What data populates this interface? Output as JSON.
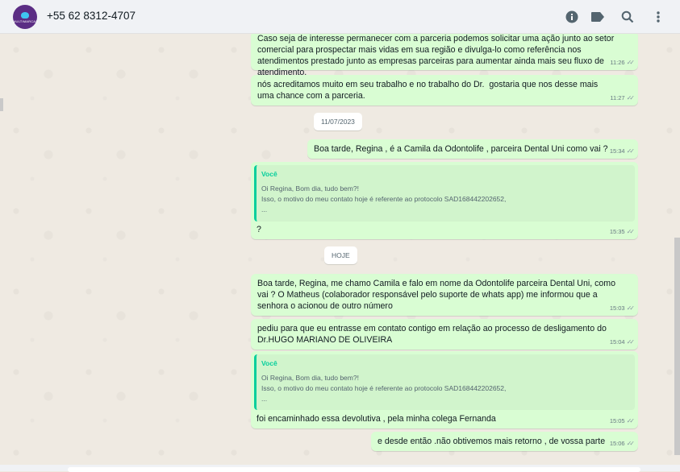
{
  "header": {
    "avatar_text": "MULTIMARCAS",
    "contact": "+55 62 8312-4707"
  },
  "icons": [
    "info-icon",
    "label-icon",
    "search-icon",
    "menu-dots-icon"
  ],
  "colors": {
    "bubble_out": "#d9fdd3",
    "quote_bar": "#06cf9c",
    "header_bg": "#f0f2f5"
  },
  "messages": {
    "m1": {
      "text": "Caso seja de interesse permanecer com a parceria podemos solicitar uma ação junto ao setor comercial para prospectar mais vidas em sua região e divulga-lo como referência nos atendimentos prestado junto as empresas parceiras para aumentar ainda mais seu fluxo de atendimento.",
      "time": "11:26"
    },
    "m2": {
      "text": "nós acreditamos muito em seu trabalho e no trabalho do Dr.  gostaria que nos desse mais uma chance com a parceria.",
      "time": "11:27"
    },
    "d1": "11/07/2023",
    "m3": {
      "text": "Boa tarde, Regina , é a Camila da Odontolife , parceira Dental Uni como vai ?",
      "time": "15:34"
    },
    "m4": {
      "quote_name": "Você",
      "quote_line1": "Oi Regina, Bom dia, tudo bem?!",
      "quote_line2": "Isso, o motivo do meu contato hoje é referente ao protocolo SAD168442202652,",
      "quote_line3": "...",
      "text": "?",
      "time": "15:35"
    },
    "d2": "HOJE",
    "m5": {
      "text": "Boa tarde, Regina, me chamo Camila e falo em nome da Odontolife parceira Dental Uni, como vai ? O Matheus (colaborador responsável pelo suporte de whats app) me informou que a senhora o acionou de outro número",
      "time": "15:03"
    },
    "m6": {
      "text": "pediu para que eu entrasse em contato contigo em relação ao processo de desligamento do Dr.HUGO MARIANO DE OLIVEIRA",
      "time": "15:04"
    },
    "m7": {
      "quote_name": "Você",
      "quote_line1": "Oi Regina, Bom dia, tudo bem?!",
      "quote_line2": "Isso, o motivo do meu contato hoje é referente ao protocolo SAD168442202652,",
      "quote_line3": "...",
      "text": "foi encaminhado essa devolutiva , pela minha colega Fernanda",
      "time": "15:05"
    },
    "m8": {
      "text": "e desde então .não obtivemos mais retorno , de vossa parte",
      "time": "15:06"
    }
  }
}
